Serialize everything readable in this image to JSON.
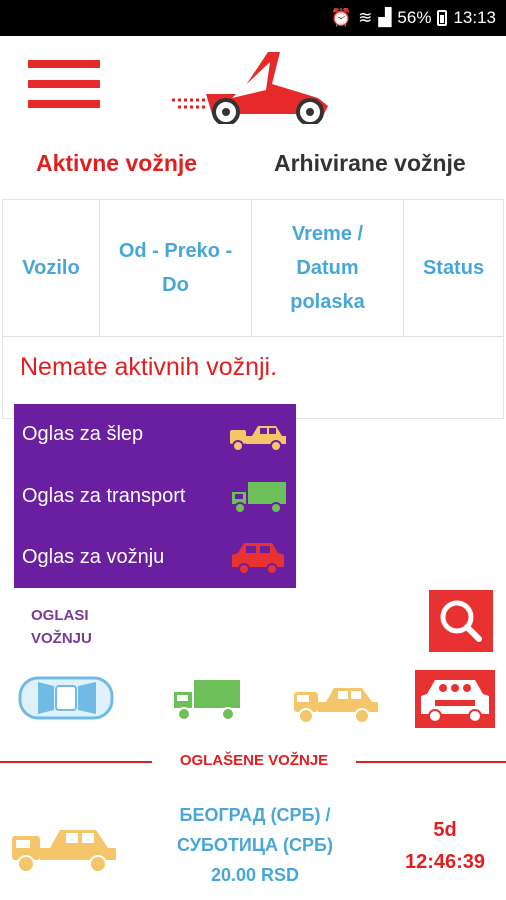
{
  "status_bar": {
    "battery": "56%",
    "time": "13:13"
  },
  "tabs": {
    "active": "Aktivne vožnje",
    "archive": "Arhivirane vožnje"
  },
  "table": {
    "headers": [
      "Vozilo",
      "Od - Preko - Do",
      "Vreme / Datum polaska",
      "Status"
    ],
    "empty_message": "Nemate aktivnih vožnji."
  },
  "menu": {
    "items": [
      {
        "label": "Oglas za šlep",
        "icon": "tow-truck-icon"
      },
      {
        "label": "Oglas za transport",
        "icon": "delivery-truck-icon"
      },
      {
        "label": "Oglas za vožnju",
        "icon": "passenger-car-icon"
      }
    ]
  },
  "oglasi": {
    "line1": "OGLASI",
    "line2": "VOŽNJU"
  },
  "divider_label": "OGLAŠENE VOŽNJE",
  "ride": {
    "route_line1": "БЕОГРАД (СРБ) /",
    "route_line2": "СУБОТИЦА (СРБ)",
    "price": "20.00 RSD",
    "days": "5d",
    "time": "12:46:39"
  },
  "colors": {
    "accent_red": "#e02020",
    "header_blue": "#48a7d8",
    "menu_purple": "#6a1fa0",
    "tow_orange": "#f5c56a",
    "truck_green": "#6dbf5a"
  }
}
